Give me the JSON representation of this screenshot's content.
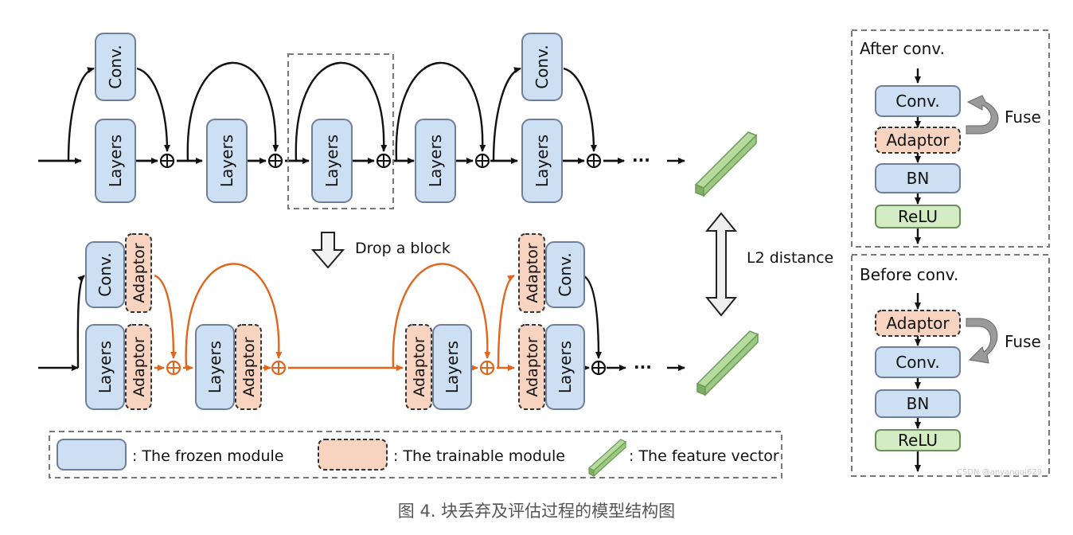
{
  "diagram": {
    "labels": {
      "conv": "Conv.",
      "layers": "Layers",
      "adaptor": "Adaptor",
      "bn": "BN",
      "relu": "ReLU",
      "ellipsis": "···",
      "drop_block": "Drop a block",
      "l2_distance": "L2 distance"
    },
    "legend": {
      "frozen": ": The frozen module",
      "trainable": ": The trainable module",
      "feature": ": The feature vector"
    },
    "after_panel": {
      "title": "After conv.",
      "fuse": "Fuse"
    },
    "before_panel": {
      "title": "Before conv.",
      "fuse": "Fuse"
    },
    "watermark": "CSDN @anyangqi629",
    "caption": "图 4. 块丢弃及评估过程的模型结构图"
  },
  "colors": {
    "frozen_fill": "#cddff2",
    "frozen_stroke": "#6f7f99",
    "trainable_fill": "#f8d3c0",
    "relu_fill": "#d4ecc4",
    "orange": "#e0661e",
    "feature_green": "#8fbf74"
  }
}
